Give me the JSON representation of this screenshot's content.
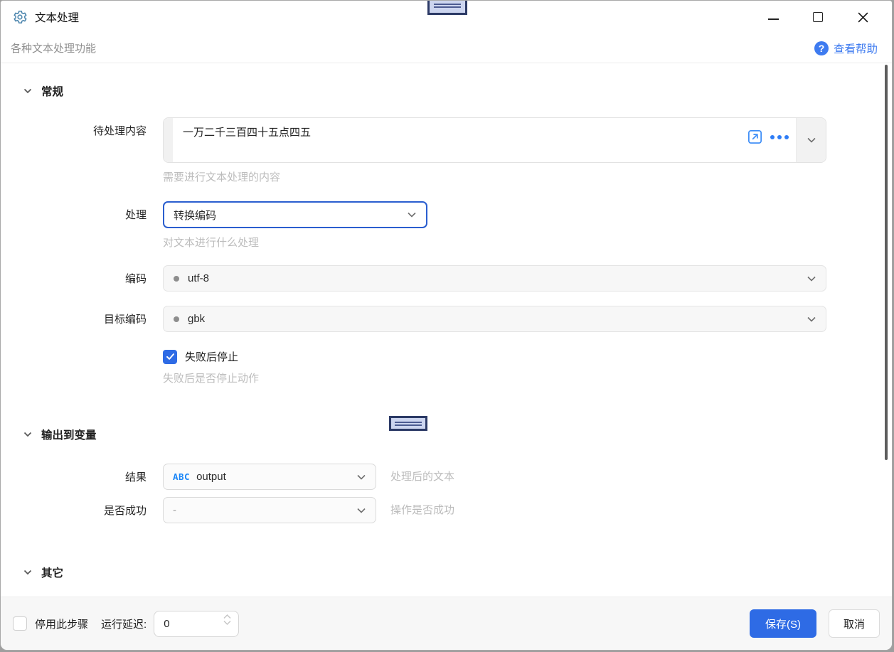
{
  "window": {
    "title": "文本处理",
    "subtitle": "各种文本处理功能",
    "help_label": "查看帮助",
    "help_icon_glyph": "?"
  },
  "sections": {
    "general": "常规",
    "output": "输出到变量",
    "other": "其它"
  },
  "fields": {
    "content": {
      "label": "待处理内容",
      "value": "一万二千三百四十五点四五",
      "help": "需要进行文本处理的内容"
    },
    "process": {
      "label": "处理",
      "value": "转换编码",
      "help": "对文本进行什么处理"
    },
    "encoding": {
      "label": "编码",
      "value": "utf-8"
    },
    "target_encoding": {
      "label": "目标编码",
      "value": "gbk"
    },
    "stop_on_fail": {
      "label": "失败后停止",
      "help": "失败后是否停止动作",
      "checked": true
    },
    "result": {
      "label": "结果",
      "var_type_tag": "ABC",
      "value": "output",
      "help": "处理后的文本"
    },
    "success": {
      "label": "是否成功",
      "value": "-",
      "help": "操作是否成功"
    }
  },
  "footer": {
    "disable_step_label": "停用此步骤",
    "delay_label": "运行延迟:",
    "delay_value": "0",
    "save_label": "保存(S)",
    "cancel_label": "取消"
  },
  "colors": {
    "accent_blue": "#2e6be5",
    "link_blue": "#3e7bf0",
    "focus_border": "#2a5ecf",
    "handle_fill": "#ccd5ef",
    "handle_border": "#2c3a66"
  }
}
